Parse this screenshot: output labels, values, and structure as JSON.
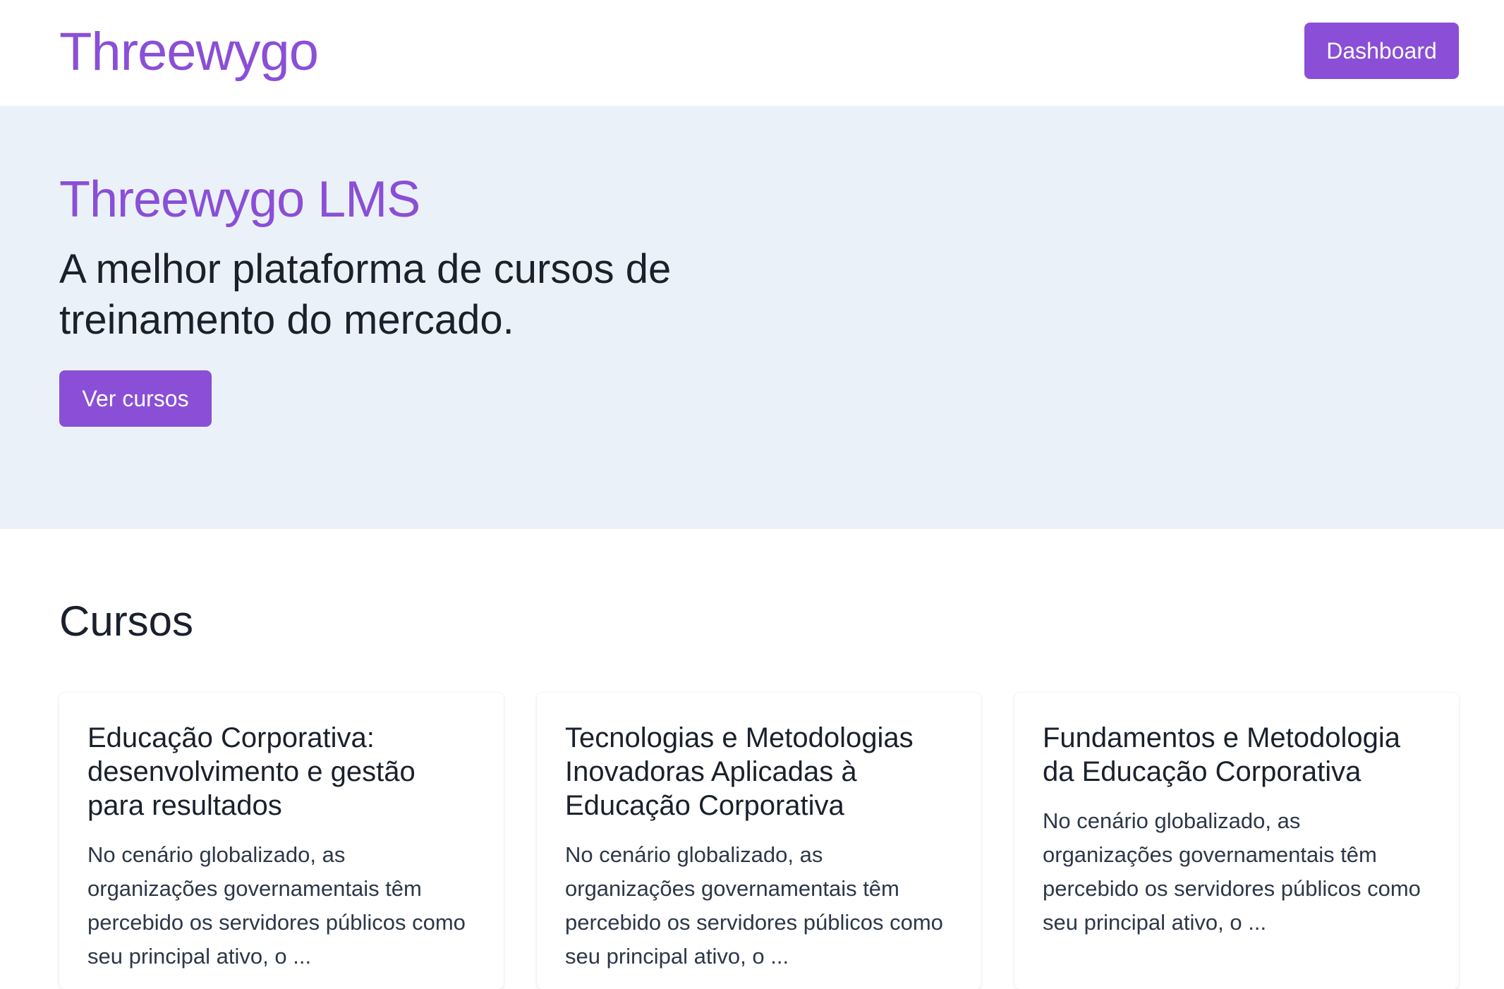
{
  "header": {
    "logo": "Threewygo",
    "dashboard_label": "Dashboard"
  },
  "hero": {
    "title": "Threewygo LMS",
    "subtitle": "A melhor plataforma de cursos de treinamento do mercado.",
    "cta_label": "Ver cursos"
  },
  "courses": {
    "section_title": "Cursos",
    "items": [
      {
        "title": "Educação Corporativa: desenvolvimento e gestão para resultados",
        "description": "No cenário globalizado, as organizações governamentais têm percebido os servidores públicos como seu principal ativo, o ..."
      },
      {
        "title": "Tecnologias e Metodologias Inovadoras Aplicadas à Educação Corporativa",
        "description": "No cenário globalizado, as organizações governamentais têm percebido os servidores públicos como seu principal ativo, o ..."
      },
      {
        "title": "Fundamentos e Metodologia da Educação Corporativa",
        "description": "No cenário globalizado, as organizações governamentais têm percebido os servidores públicos como seu principal ativo, o ..."
      }
    ]
  },
  "colors": {
    "brand": "#8a4fd6",
    "hero_bg": "#ebf1f8",
    "text": "#1a202c"
  }
}
